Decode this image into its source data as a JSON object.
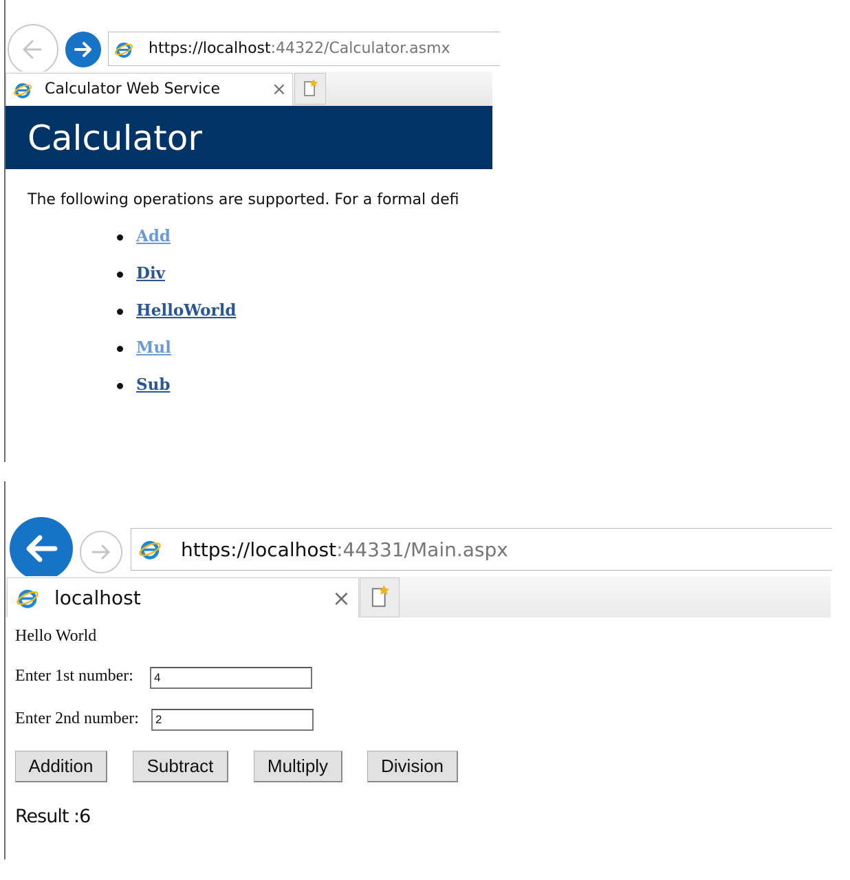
{
  "window1": {
    "address_host": "https://localhost",
    "address_path": ":44322/Calculator.asmx",
    "tab_title": "Calculator Web Service",
    "tab_close": "×",
    "banner_title": "Calculator",
    "intro_text": "The following operations are supported. For a formal defi",
    "operations": [
      {
        "label": "Add",
        "color": "#6b9ad6"
      },
      {
        "label": "Div",
        "color": "#2a5696"
      },
      {
        "label": "HelloWorld",
        "color": "#2a5696"
      },
      {
        "label": "Mul",
        "color": "#6b9ad6"
      },
      {
        "label": "Sub",
        "color": "#2a5696"
      }
    ]
  },
  "window2": {
    "address_host": "https://localhost",
    "address_path": ":44331/Main.aspx",
    "tab_title": "localhost",
    "tab_close": "×",
    "hello_text": "Hello World",
    "first_label": "Enter 1st number:",
    "first_value": "4",
    "second_label": "Enter 2nd number:",
    "second_value": "2",
    "buttons": {
      "addition": "Addition",
      "subtract": "Subtract",
      "multiply": "Multiply",
      "division": "Division"
    },
    "result_text": "Result :6"
  },
  "colors": {
    "banner": "#003366",
    "ie_blue": "#1773c6"
  },
  "icons": [
    "back-arrow-icon",
    "forward-arrow-icon",
    "ie-logo-icon",
    "close-icon",
    "new-tab-icon"
  ]
}
